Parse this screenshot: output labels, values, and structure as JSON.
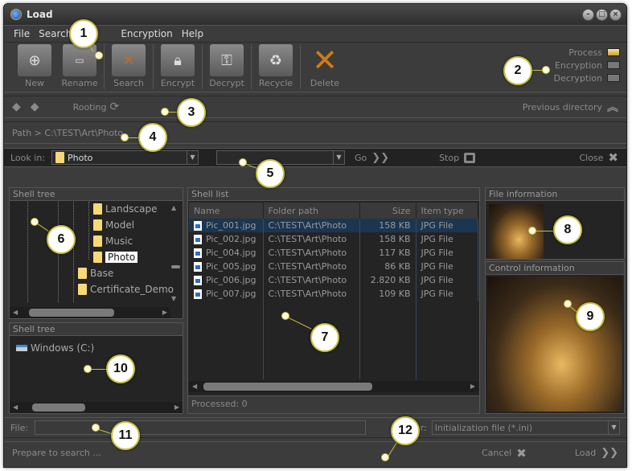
{
  "window": {
    "title": "Load"
  },
  "menu": [
    "File",
    "Search",
    "Encryption",
    "Help"
  ],
  "toolbar": [
    {
      "label": "New",
      "icon": "new-folder-icon"
    },
    {
      "label": "Rename",
      "icon": "rename-icon"
    },
    {
      "label": "Search",
      "icon": "binoculars-icon"
    },
    {
      "label": "Encrypt",
      "icon": "padlock-icon"
    },
    {
      "label": "Decrypt",
      "icon": "key-icon"
    },
    {
      "label": "Recycle",
      "icon": "recycle-icon"
    },
    {
      "label": "Delete",
      "icon": "delete-x-icon"
    }
  ],
  "status_legend": [
    {
      "label": "Process",
      "active": true
    },
    {
      "label": "Encryption",
      "active": false
    },
    {
      "label": "Decryption",
      "active": false
    }
  ],
  "nav": {
    "rooting": "Rooting",
    "previous_directory": "Previous directory"
  },
  "path": {
    "prefix": "Path >",
    "value": "C:\\TEST\\Art\\Photo"
  },
  "lookin": {
    "label": "Look in:",
    "value": "Photo",
    "go": "Go",
    "stop": "Stop",
    "close": "Close"
  },
  "shell_tree": {
    "title": "Shell tree",
    "items": [
      "Landscape",
      "Model",
      "Music",
      "Photo",
      "Base",
      "Certificate_Demo"
    ],
    "selected": "Photo"
  },
  "shell_tree2": {
    "title": "Shell tree",
    "drive": "Windows (C:)"
  },
  "shell_list": {
    "title": "Shell list",
    "columns": [
      "Name",
      "Folder path",
      "Size",
      "Item type"
    ],
    "rows": [
      [
        "Pic_001.jpg",
        "C:\\TEST\\Art\\Photo",
        "158 KB",
        "JPG File"
      ],
      [
        "Pic_002.jpg",
        "C:\\TEST\\Art\\Photo",
        "158 KB",
        "JPG File"
      ],
      [
        "Pic_004.jpg",
        "C:\\TEST\\Art\\Photo",
        "117 KB",
        "JPG File"
      ],
      [
        "Pic_005.jpg",
        "C:\\TEST\\Art\\Photo",
        "86 KB",
        "JPG File"
      ],
      [
        "Pic_006.jpg",
        "C:\\TEST\\Art\\Photo",
        "2.820 KB",
        "JPG File"
      ],
      [
        "Pic_007.jpg",
        "C:\\TEST\\Art\\Photo",
        "109 KB",
        "JPG File"
      ]
    ],
    "processed": "Processed: 0"
  },
  "file_info": {
    "title": "File information"
  },
  "control_info": {
    "title": "Control information"
  },
  "bottom": {
    "file_label": "File:",
    "file_value": "",
    "filter_label": "r:",
    "filter_value": "Initialization file (*.ini)",
    "status": "Prepare to search ...",
    "cancel": "Cancel",
    "load": "Load"
  },
  "callouts": [
    "1",
    "2",
    "3",
    "4",
    "5",
    "6",
    "7",
    "8",
    "9",
    "10",
    "11",
    "12"
  ]
}
